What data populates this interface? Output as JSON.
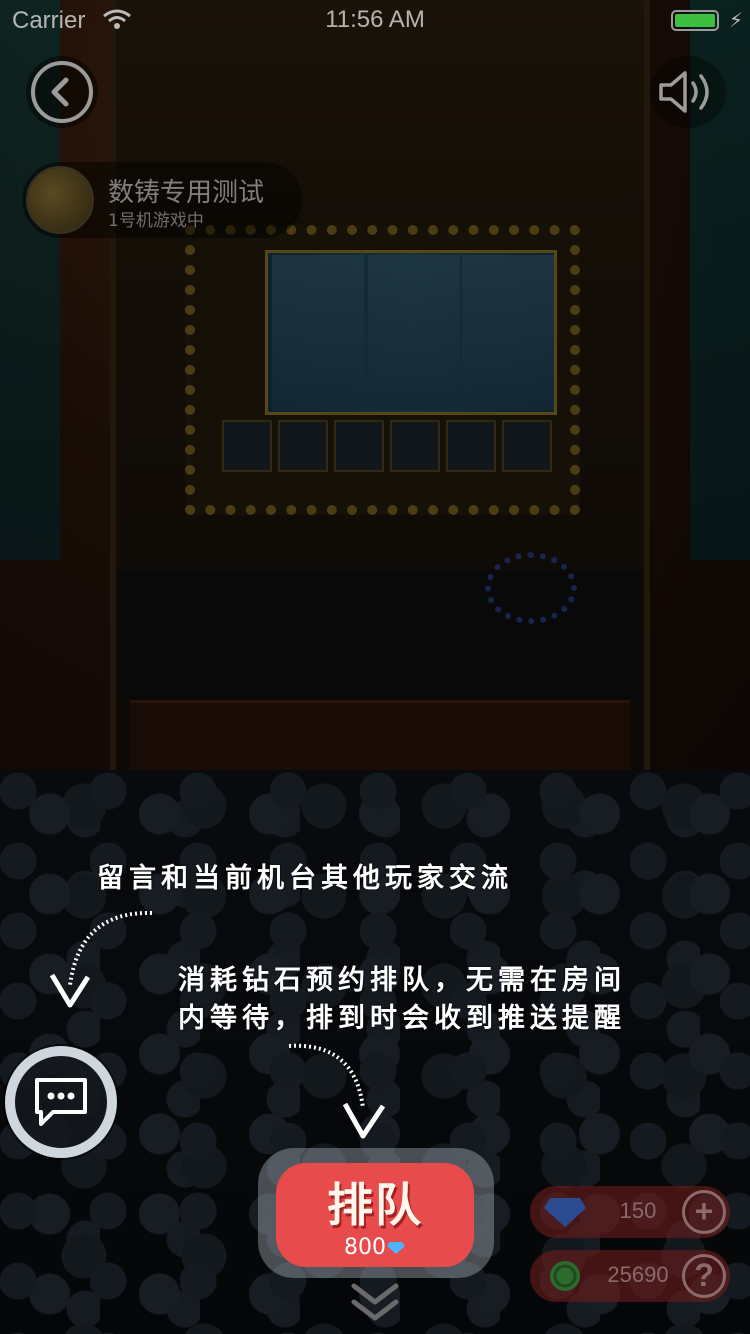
{
  "status_bar": {
    "carrier": "Carrier",
    "time": "11:56 AM"
  },
  "room": {
    "name": "数铸专用测试",
    "status": "1号机游戏中"
  },
  "guide": {
    "chat_tip": "留言和当前机台其他玩家交流",
    "queue_tip_line1": "消耗钻石预约排队，无需在房间",
    "queue_tip_line2": "内等待，排到时会收到推送提醒"
  },
  "queue_button": {
    "label": "排队",
    "cost": "800"
  },
  "balances": {
    "diamonds": {
      "value": "150",
      "action": "+"
    },
    "coins": {
      "value": "25690",
      "action": "?"
    }
  },
  "colors": {
    "queue_button": "#e84b4b",
    "overlay_text": "#ffffff",
    "battery": "#3fbf3f"
  },
  "icons": [
    "back-icon",
    "speaker-icon",
    "wifi-icon",
    "battery-icon",
    "chat-bubble-icon",
    "diamond-icon",
    "coin-icon",
    "chevron-down-icon",
    "curved-arrow-icon"
  ]
}
